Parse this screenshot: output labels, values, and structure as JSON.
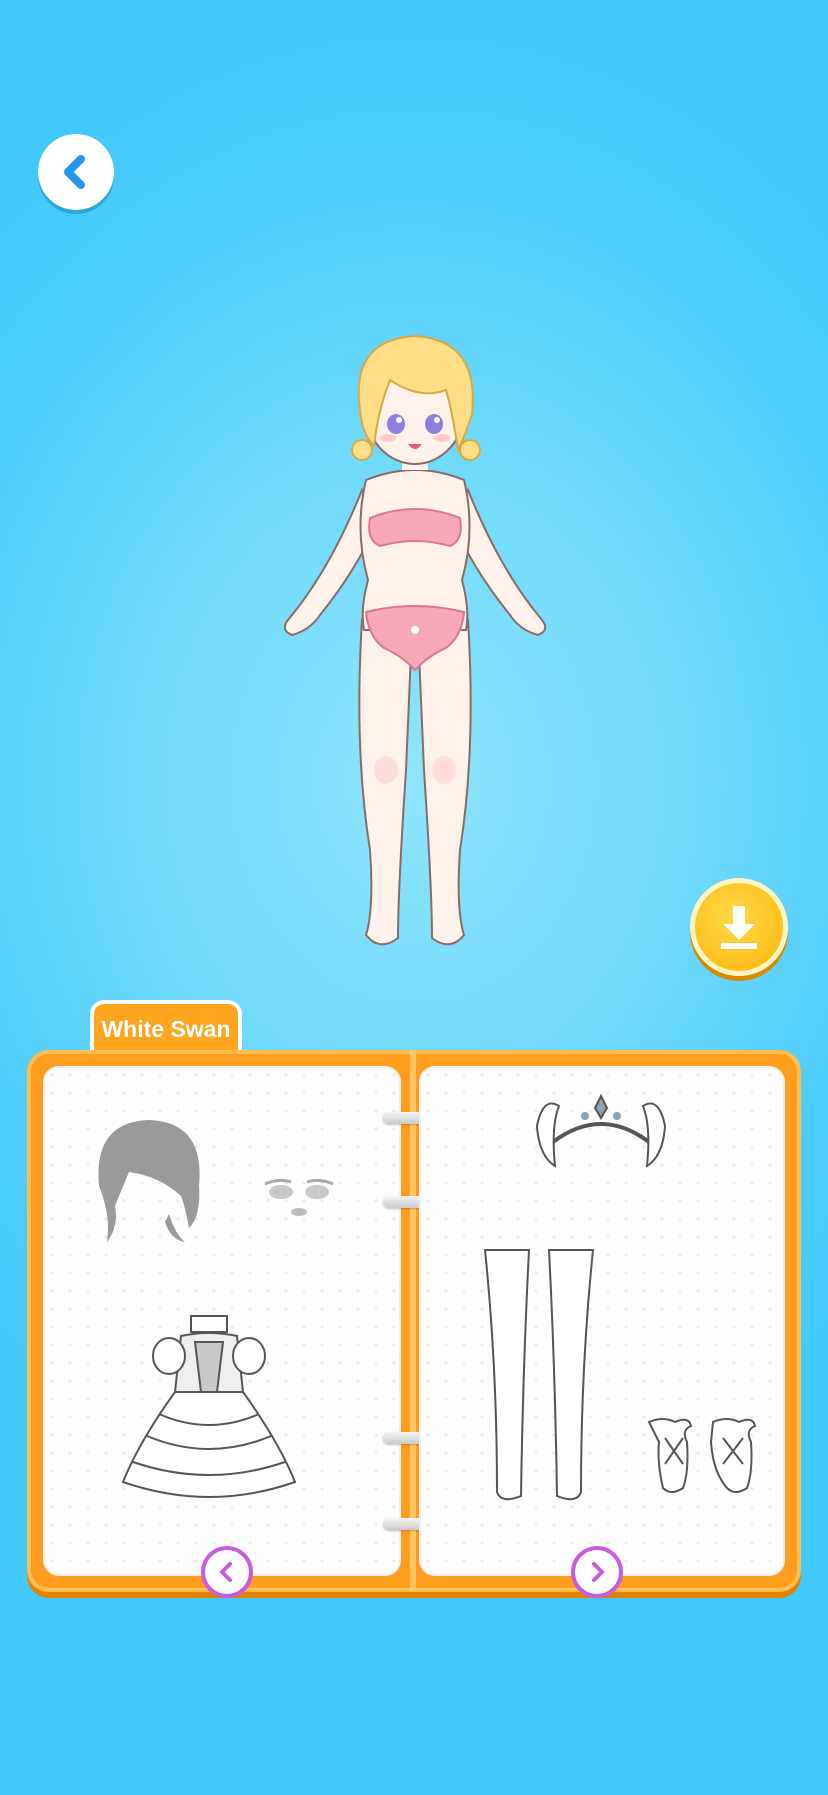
{
  "header": {
    "back_icon": "chevron-left-icon"
  },
  "actions": {
    "download_icon": "download-icon"
  },
  "book": {
    "tab_label": "White Swan",
    "left_page_items": [
      "hair",
      "face",
      "dress"
    ],
    "right_page_items": [
      "tiara",
      "stockings",
      "ballet-shoes"
    ],
    "prev_icon": "chevron-left-icon",
    "next_icon": "chevron-right-icon"
  },
  "colors": {
    "background": "#4dcdfb",
    "book": "#ff9d1f",
    "nav_accent": "#c85be0",
    "download": "#ffc21f"
  }
}
